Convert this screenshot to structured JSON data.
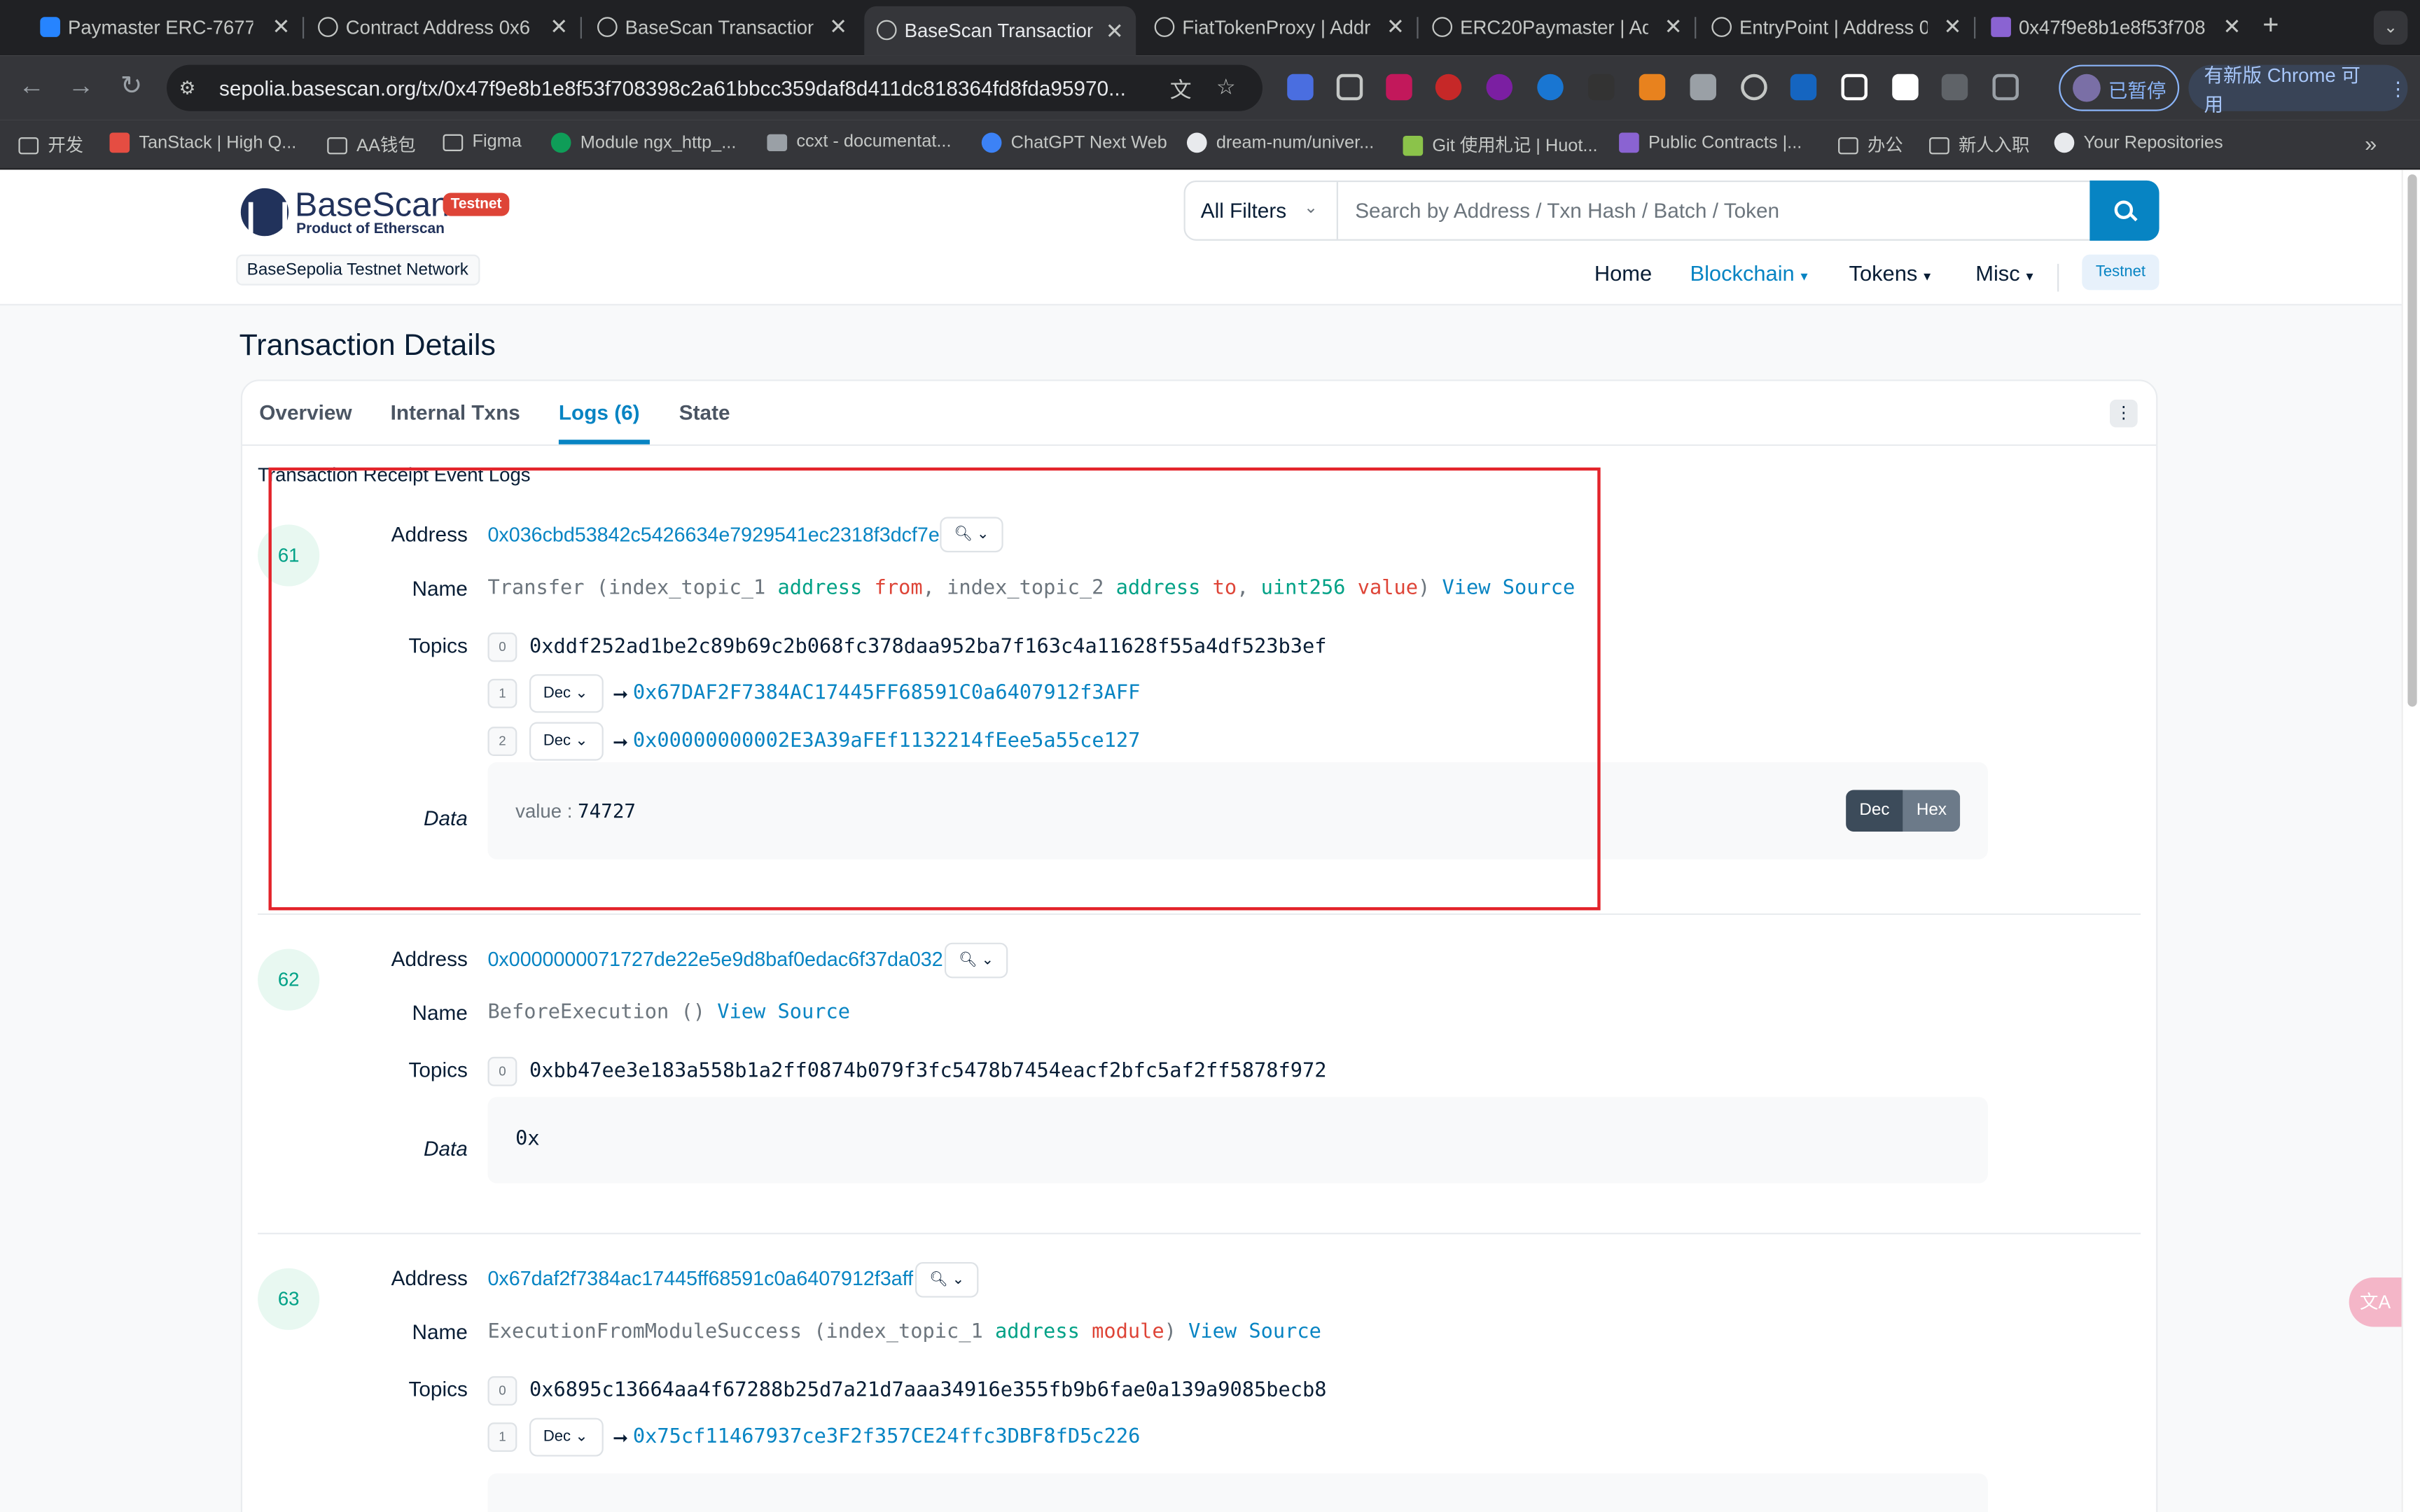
{
  "browser": {
    "tabs": [
      {
        "title": "Paymaster ERC-7677 ·"
      },
      {
        "title": "Contract Address 0x6"
      },
      {
        "title": "BaseScan Transaction"
      },
      {
        "title": "BaseScan Transaction"
      },
      {
        "title": "FiatTokenProxy | Addre"
      },
      {
        "title": "ERC20Paymaster | Add"
      },
      {
        "title": "EntryPoint | Address 0"
      },
      {
        "title": "0x47f9e8b1e8f53f708"
      }
    ],
    "url": "sepolia.basescan.org/tx/0x47f9e8b1e8f53f708398c2a61bbcc359daf8d411dc818364fd8fda95970...",
    "paused_label": "已暂停",
    "update_label": "有新版 Chrome 可用",
    "bookmarks": [
      {
        "label": "开发",
        "icon": "folder-icon"
      },
      {
        "label": "TanStack | High Q...",
        "icon": "tanstack-icon"
      },
      {
        "label": "AA钱包",
        "icon": "folder-icon"
      },
      {
        "label": "Figma",
        "icon": "folder-icon"
      },
      {
        "label": "Module ngx_http_...",
        "icon": "nginx-icon"
      },
      {
        "label": "ccxt - documentat...",
        "icon": "ccxt-icon"
      },
      {
        "label": "ChatGPT Next Web",
        "icon": "chatgpt-icon"
      },
      {
        "label": "dream-num/univer...",
        "icon": "github-icon"
      },
      {
        "label": "Git 使用札记 | Huot...",
        "icon": "k-icon"
      },
      {
        "label": "Public Contracts |...",
        "icon": "triangle-icon"
      },
      {
        "label": "办公",
        "icon": "folder-icon"
      },
      {
        "label": "新人入职",
        "icon": "folder-icon"
      },
      {
        "label": "Your Repositories",
        "icon": "github-icon"
      }
    ]
  },
  "site": {
    "logo_text": "BaseScan",
    "logo_sub": "Product of Etherscan",
    "testnet_badge": "Testnet",
    "network": "BaseSepolia Testnet Network",
    "filter": "All Filters",
    "search_placeholder": "Search by Address / Txn Hash / Batch / Token",
    "nav": [
      "Home",
      "Blockchain",
      "Tokens",
      "Misc"
    ],
    "nav_testnet": "Testnet"
  },
  "page": {
    "title": "Transaction Details",
    "tabs": [
      "Overview",
      "Internal Txns",
      "Logs (6)",
      "State"
    ],
    "section_header": "Transaction Receipt Event Logs",
    "labels": {
      "address": "Address",
      "name": "Name",
      "topics": "Topics",
      "data": "Data"
    },
    "dec": "Dec",
    "hex": "Hex",
    "view_source": "View Source"
  },
  "logs": [
    {
      "index": "61",
      "address": "0x036cbd53842c5426634e7929541ec2318f3dcf7e",
      "name": {
        "fn": "Transfer",
        "params": [
          {
            "prefix": "index_topic_1",
            "type": "address",
            "var": "from"
          },
          {
            "prefix": "index_topic_2",
            "type": "address",
            "var": "to"
          },
          {
            "prefix": "",
            "type": "uint256",
            "var": "value"
          }
        ]
      },
      "topics": [
        {
          "i": "0",
          "value": "0xddf252ad1be2c89b69c2b068fc378daa952ba7f163c4a11628f55a4df523b3ef"
        },
        {
          "i": "1",
          "decoded": "0x67DAF2F7384AC17445FF68591C0a6407912f3AFF"
        },
        {
          "i": "2",
          "decoded": "0x00000000002E3A39aFEf1132214fEee5a55ce127"
        }
      ],
      "data_key": "value :",
      "data_val": "74727"
    },
    {
      "index": "62",
      "address": "0x0000000071727de22e5e9d8baf0edac6f37da032",
      "name": {
        "fn": "BeforeExecution",
        "params": []
      },
      "topics": [
        {
          "i": "0",
          "value": "0xbb47ee3e183a558b1a2ff0874b079f3fc5478b7454eacf2bfc5af2ff5878f972"
        }
      ],
      "data_val": "0x"
    },
    {
      "index": "63",
      "address": "0x67daf2f7384ac17445ff68591c0a6407912f3aff",
      "name": {
        "fn": "ExecutionFromModuleSuccess",
        "params": [
          {
            "prefix": "index_topic_1",
            "type": "address",
            "var": "module"
          }
        ]
      },
      "topics": [
        {
          "i": "0",
          "value": "0x6895c13664aa4f67288b25d7a21d7aaa34916e355fb9b6fae0a139a9085becb8"
        },
        {
          "i": "1",
          "decoded": "0x75cf11467937ce3F2f357CE24ffc3DBF8fD5c226"
        }
      ]
    }
  ]
}
